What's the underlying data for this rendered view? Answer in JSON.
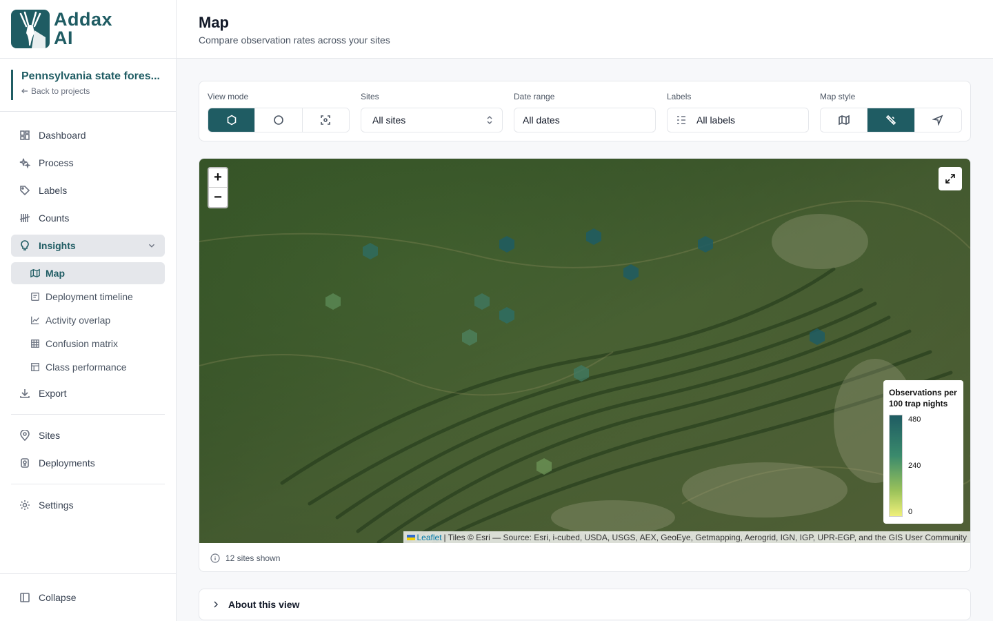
{
  "brand": {
    "line1": "Addax",
    "line2": "AI",
    "color": "#1f5c63"
  },
  "project": {
    "title": "Pennsylvania state fores...",
    "back_label": "Back to projects"
  },
  "nav": {
    "dashboard": "Dashboard",
    "process": "Process",
    "labels": "Labels",
    "counts": "Counts",
    "insights": "Insights",
    "insights_children": {
      "map": "Map",
      "deployment_timeline": "Deployment timeline",
      "activity_overlap": "Activity overlap",
      "confusion_matrix": "Confusion matrix",
      "class_performance": "Class performance"
    },
    "export": "Export",
    "sites": "Sites",
    "deployments": "Deployments",
    "settings": "Settings",
    "collapse": "Collapse"
  },
  "header": {
    "title": "Map",
    "subtitle": "Compare observation rates across your sites"
  },
  "controls": {
    "view_mode": {
      "label": "View mode",
      "options": [
        "hexagon-icon",
        "circle-icon",
        "scan-icon"
      ],
      "selected": 0
    },
    "sites": {
      "label": "Sites",
      "value": "All sites"
    },
    "date_range": {
      "label": "Date range",
      "value": "All dates"
    },
    "labels": {
      "label": "Labels",
      "value": "All labels"
    },
    "map_style": {
      "label": "Map style",
      "options": [
        "map-icon",
        "satellite-icon",
        "navigation-icon"
      ],
      "selected": 1
    }
  },
  "map": {
    "zoom_in": "+",
    "zoom_out": "−",
    "legend": {
      "title": "Observations per 100 trap nights",
      "max": "480",
      "mid": "240",
      "min": "0"
    },
    "attribution": {
      "leaflet": "Leaflet",
      "text": "| Tiles © Esri — Source: Esri, i-cubed, USDA, USGS, AEX, GeoEye, Getmapping, Aerogrid, IGN, IGP, UPR-EGP, and the GIS User Community"
    },
    "sites_shown": "12 sites shown"
  },
  "about": {
    "label": "About this view"
  }
}
